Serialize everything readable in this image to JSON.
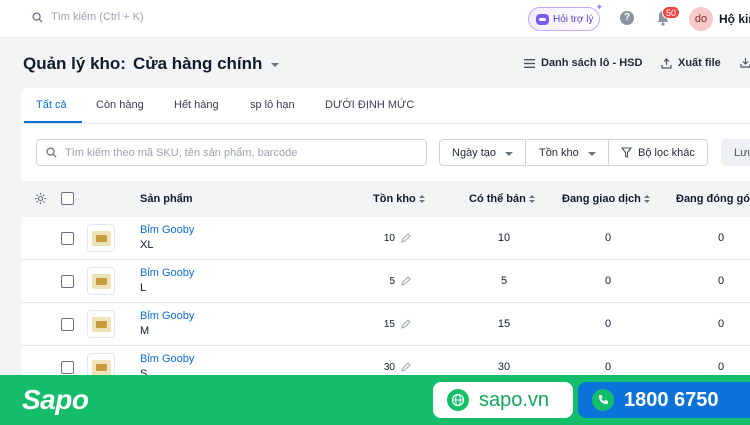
{
  "topbar": {
    "search_placeholder": "Tìm kiếm (Ctrl + K)",
    "assistant_label": "Hỏi trợ lý",
    "notification_count": "50",
    "avatar_initials": "do",
    "user_name": "Hộ kin"
  },
  "header": {
    "title": "Quản lý kho:",
    "store": "Cửa hàng chính",
    "lot_list": "Danh sách lô - HSD",
    "export": "Xuất file"
  },
  "tabs": [
    "Tất cả",
    "Còn hàng",
    "Hết hàng",
    "sp lô hạn",
    "DƯỚI ĐỊNH MỨC"
  ],
  "filters": {
    "search_placeholder": "Tìm kiếm theo mã SKU, tên sản phẩm, barcode",
    "date_created": "Ngày tạo",
    "stock": "Tồn kho",
    "other_filter": "Bộ lọc khác",
    "save": "Lưu"
  },
  "table": {
    "headers": {
      "product": "Sản phẩm",
      "stock": "Tồn kho",
      "available": "Có thể bán",
      "in_transaction": "Đang giao dịch",
      "packing": "Đang đóng gói"
    },
    "rows": [
      {
        "name": "Bỉm Gooby",
        "variant": "XL",
        "stock": "10",
        "available": "10",
        "in_transaction": "0",
        "packing": "0"
      },
      {
        "name": "Bỉm Gooby",
        "variant": "L",
        "stock": "5",
        "available": "5",
        "in_transaction": "0",
        "packing": "0"
      },
      {
        "name": "Bỉm Gooby",
        "variant": "M",
        "stock": "15",
        "available": "15",
        "in_transaction": "0",
        "packing": "0"
      },
      {
        "name": "Bỉm Gooby",
        "variant": "S",
        "stock": "30",
        "available": "30",
        "in_transaction": "0",
        "packing": "0"
      }
    ]
  },
  "banner": {
    "logo": "Sapo",
    "website": "sapo.vn",
    "phone": "1800 6750"
  },
  "colors": {
    "accent": "#0b6fd6",
    "brand_green": "#14bd6a",
    "phone_blue": "#0a73d9",
    "badge_red": "#ef4444"
  }
}
